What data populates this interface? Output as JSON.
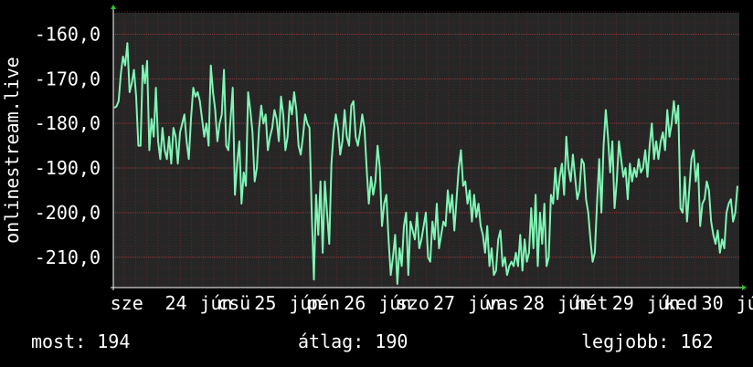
{
  "chart_data": {
    "type": "line",
    "ylabel": "onlinestream.live",
    "ylim": [
      -216.8,
      -155.2
    ],
    "yticks": [
      -160,
      -170,
      -180,
      -190,
      -200,
      -210
    ],
    "ytick_labels": [
      "-160,0",
      "-170,0",
      "-180,0",
      "-190,0",
      "-200,0",
      "-210,0"
    ],
    "xlim": [
      0,
      14
    ],
    "xtick_labels": [
      {
        "x": 0.3,
        "label": "sze"
      },
      {
        "x": 1.4,
        "label": "24"
      },
      {
        "x": 2.3,
        "label": "jún"
      },
      {
        "x": 2.7,
        "label": "csü"
      },
      {
        "x": 3.4,
        "label": "25"
      },
      {
        "x": 4.3,
        "label": "jún"
      },
      {
        "x": 4.7,
        "label": "pén"
      },
      {
        "x": 5.4,
        "label": "26"
      },
      {
        "x": 6.3,
        "label": "jún"
      },
      {
        "x": 6.7,
        "label": "szo"
      },
      {
        "x": 7.4,
        "label": "27"
      },
      {
        "x": 8.3,
        "label": "jún"
      },
      {
        "x": 8.7,
        "label": "vas"
      },
      {
        "x": 9.4,
        "label": "28"
      },
      {
        "x": 10.3,
        "label": "jún"
      },
      {
        "x": 10.7,
        "label": "hét"
      },
      {
        "x": 11.4,
        "label": "29"
      },
      {
        "x": 12.3,
        "label": "jún"
      },
      {
        "x": 12.7,
        "label": "ked"
      },
      {
        "x": 13.4,
        "label": "30"
      },
      {
        "x": 14.3,
        "label": "jún"
      }
    ],
    "grid": true,
    "series": [
      {
        "color": "#7ff5b5",
        "values": [
          -176.5,
          -176.2,
          -175.0,
          -169.0,
          -165.0,
          -167.0,
          -162.0,
          -173.0,
          -171.0,
          -168.0,
          -174.0,
          -185.0,
          -185.0,
          -167.0,
          -171.0,
          -166.0,
          -186.0,
          -179.0,
          -183.0,
          -172.0,
          -184.0,
          -188.0,
          -181.0,
          -186.0,
          -188.0,
          -183.0,
          -189.0,
          -181.0,
          -183.0,
          -189.0,
          -182.0,
          -180.0,
          -178.0,
          -184.0,
          -188.0,
          -179.0,
          -172.0,
          -174.0,
          -173.0,
          -175.0,
          -179.0,
          -183.0,
          -180.0,
          -185.0,
          -167.0,
          -173.0,
          -177.0,
          -184.0,
          -180.0,
          -178.0,
          -168.0,
          -185.0,
          -186.0,
          -179.0,
          -172.0,
          -196.0,
          -189.0,
          -184.0,
          -198.0,
          -191.0,
          -194.0,
          -173.0,
          -177.0,
          -182.0,
          -193.0,
          -190.0,
          -181.0,
          -176.0,
          -180.0,
          -178.0,
          -186.0,
          -183.0,
          -181.0,
          -177.0,
          -179.0,
          -184.0,
          -174.0,
          -178.0,
          -186.0,
          -183.0,
          -175.0,
          -178.0,
          -173.0,
          -177.0,
          -185.0,
          -187.0,
          -183.0,
          -178.0,
          -180.0,
          -181.0,
          -200.0,
          -215.0,
          -196.0,
          -205.0,
          -193.0,
          -209.0,
          -193.0,
          -200.0,
          -207.0,
          -189.0,
          -182.0,
          -178.0,
          -181.0,
          -187.0,
          -184.0,
          -177.0,
          -183.0,
          -185.0,
          -176.0,
          -175.0,
          -183.0,
          -185.0,
          -182.0,
          -178.0,
          -181.0,
          -190.0,
          -198.0,
          -192.0,
          -196.0,
          -193.0,
          -185.0,
          -190.0,
          -203.0,
          -198.0,
          -196.0,
          -206.0,
          -214.0,
          -210.0,
          -205.0,
          -216.0,
          -208.0,
          -212.0,
          -203.0,
          -200.0,
          -214.0,
          -202.0,
          -204.0,
          -206.0,
          -200.0,
          -208.0,
          -206.0,
          -203.0,
          -200.0,
          -210.0,
          -211.0,
          -202.0,
          -206.0,
          -198.0,
          -208.0,
          -205.0,
          -202.0,
          -203.0,
          -195.0,
          -200.0,
          -196.0,
          -204.0,
          -197.0,
          -190.0,
          -186.0,
          -194.0,
          -193.0,
          -198.0,
          -195.0,
          -202.0,
          -196.0,
          -201.0,
          -198.0,
          -203.0,
          -205.0,
          -209.0,
          -203.0,
          -212.0,
          -208.0,
          -214.0,
          -213.0,
          -206.0,
          -204.0,
          -212.0,
          -210.0,
          -214.0,
          -212.0,
          -211.0,
          -212.0,
          -209.0,
          -212.0,
          -205.0,
          -213.0,
          -206.0,
          -211.0,
          -209.0,
          -199.0,
          -208.0,
          -196.0,
          -212.0,
          -200.0,
          -207.0,
          -198.0,
          -212.0,
          -210.0,
          -196.0,
          -198.0,
          -190.0,
          -197.0,
          -192.0,
          -189.0,
          -196.0,
          -183.0,
          -190.0,
          -193.0,
          -187.0,
          -192.0,
          -197.0,
          -195.0,
          -188.0,
          -189.0,
          -197.0,
          -200.0,
          -206.0,
          -211.0,
          -209.0,
          -198.0,
          -188.0,
          -200.0,
          -185.0,
          -177.0,
          -183.0,
          -191.0,
          -184.0,
          -199.0,
          -193.0,
          -184.0,
          -188.0,
          -192.0,
          -190.0,
          -197.0,
          -189.0,
          -193.0,
          -190.0,
          -192.0,
          -188.0,
          -191.0,
          -190.0,
          -186.0,
          -192.0,
          -185.0,
          -180.0,
          -188.0,
          -184.0,
          -188.0,
          -184.0,
          -182.0,
          -186.0,
          -177.0,
          -183.0,
          -180.0,
          -175.0,
          -180.0,
          -176.0,
          -199.0,
          -200.0,
          -192.0,
          -202.0,
          -195.0,
          -188.0,
          -186.0,
          -193.0,
          -189.0,
          -203.0,
          -198.0,
          -197.0,
          -193.0,
          -195.0,
          -202.0,
          -205.0,
          -207.0,
          -204.0,
          -209.0,
          -206.0,
          -208.0,
          -200.0,
          -198.0,
          -197.0,
          -202.0,
          -200.0,
          -194.0
        ]
      }
    ]
  },
  "summary": {
    "current": "most: 194",
    "average": "átlag: 190",
    "best": "legjobb: 162"
  }
}
